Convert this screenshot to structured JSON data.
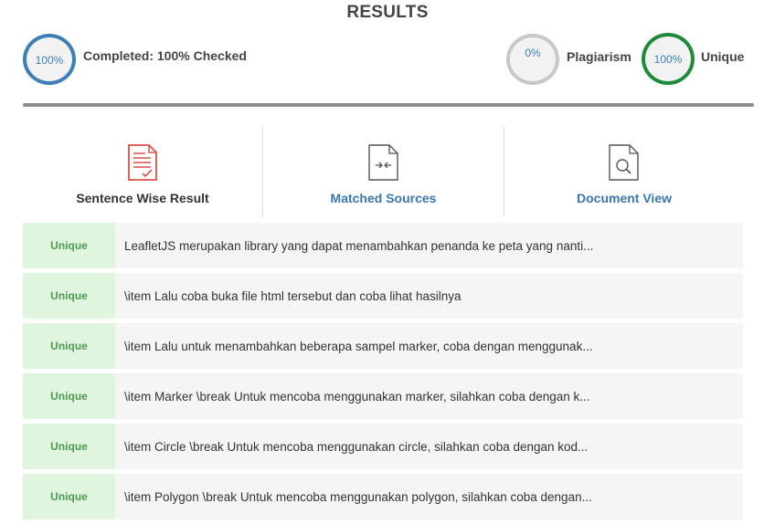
{
  "header": {
    "title": "RESULTS"
  },
  "summary": {
    "completed": {
      "percent": "100%",
      "label": "Completed: 100% Checked",
      "ring_color": "#3d7fb6"
    },
    "plagiarism": {
      "percent": "0%",
      "label": "Plagiarism",
      "ring_color": "#c8c8c8"
    },
    "unique": {
      "percent": "100%",
      "label": "Unique",
      "ring_color": "#1e8a3c"
    }
  },
  "tabs": [
    {
      "label": "Sentence Wise Result",
      "icon": "document-check-icon",
      "color": "#d9534f"
    },
    {
      "label": "Matched Sources",
      "icon": "compare-arrows-icon",
      "color": "#3a76ad"
    },
    {
      "label": "Document View",
      "icon": "magnifier-document-icon",
      "color": "#3a76ad"
    }
  ],
  "results": [
    {
      "status": "Unique",
      "text": "LeafletJS merupakan library yang dapat menambahkan penanda ke peta yang nanti..."
    },
    {
      "status": "Unique",
      "text": "\\item Lalu coba buka file html tersebut dan coba lihat hasilnya"
    },
    {
      "status": "Unique",
      "text": "\\item Lalu untuk menambahkan beberapa sampel marker, coba dengan menggunak..."
    },
    {
      "status": "Unique",
      "text": "\\item Marker \\break Untuk mencoba menggunakan marker, silahkan coba dengan k..."
    },
    {
      "status": "Unique",
      "text": "\\item Circle \\break Untuk mencoba menggunakan circle, silahkan coba dengan kod..."
    },
    {
      "status": "Unique",
      "text": "\\item Polygon \\break Untuk mencoba menggunakan polygon, silahkan coba dengan..."
    }
  ]
}
